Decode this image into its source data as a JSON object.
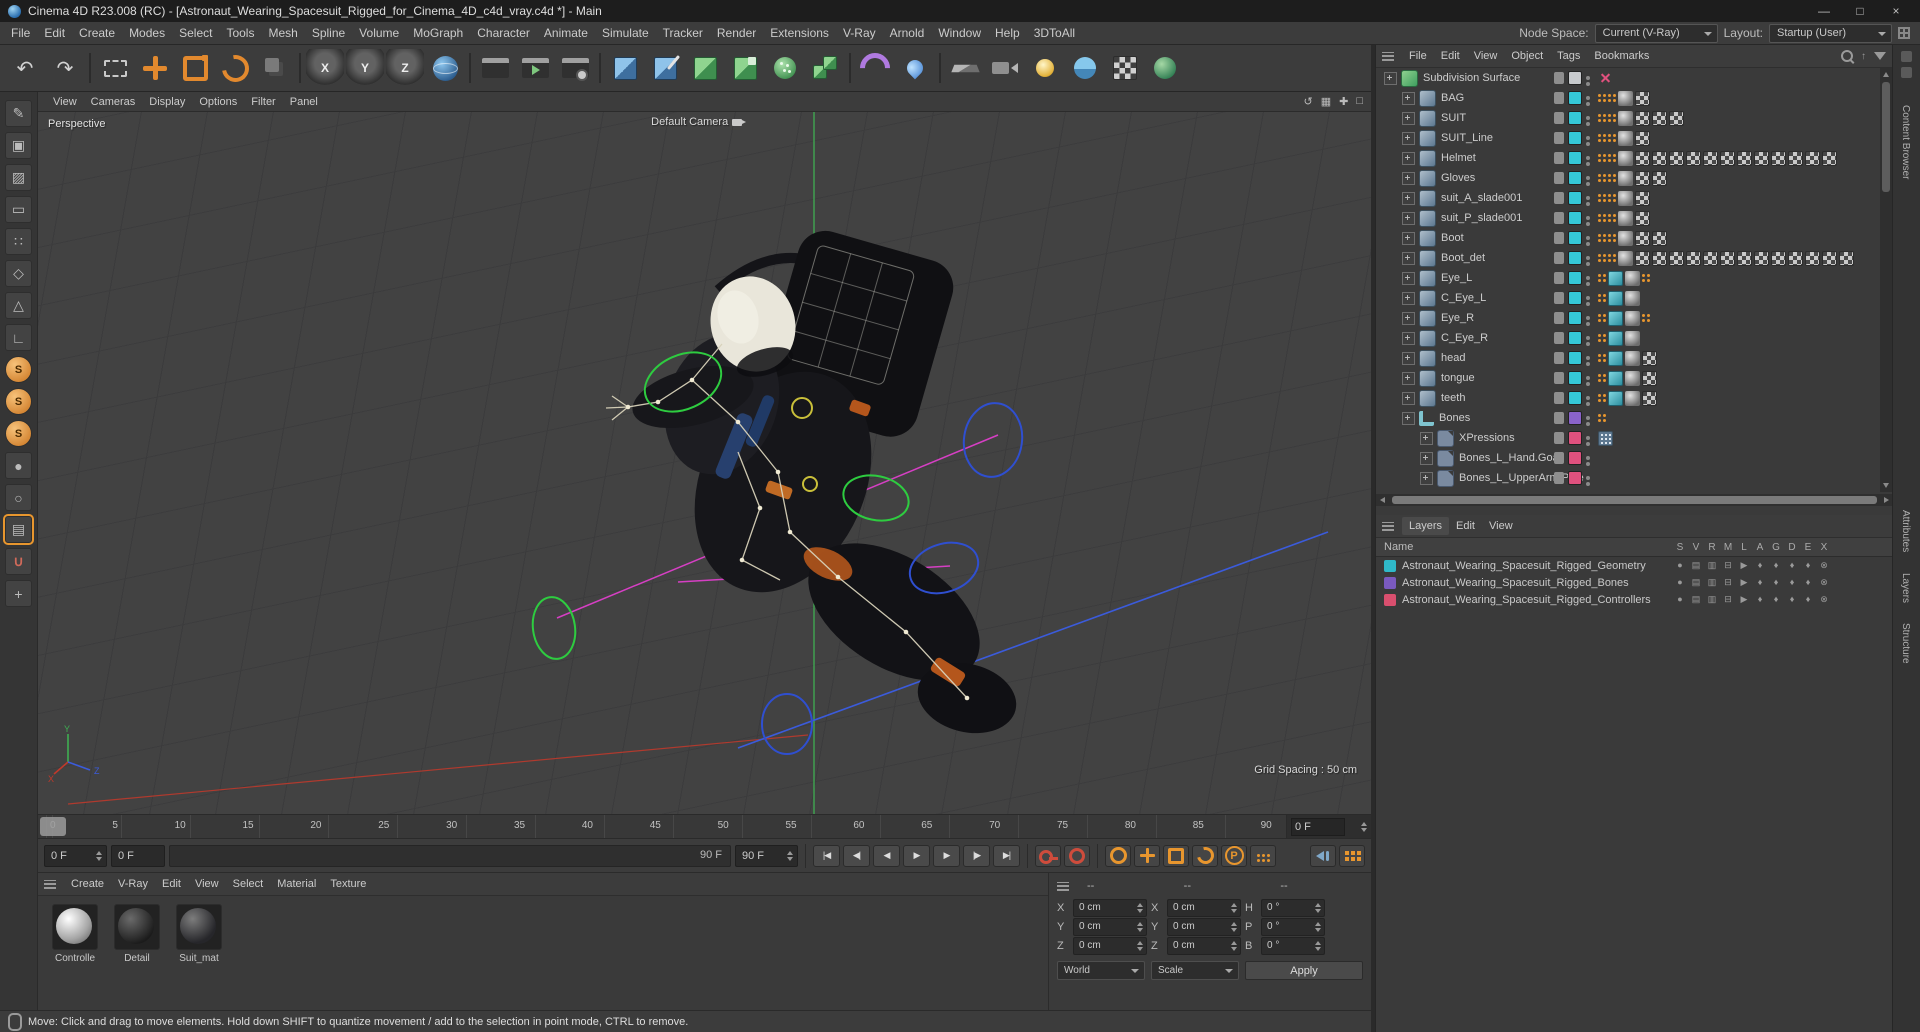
{
  "window": {
    "title": "Cinema 4D R23.008 (RC) - [Astronaut_Wearing_Spacesuit_Rigged_for_Cinema_4D_c4d_vray.c4d *] - Main",
    "min": "—",
    "max": "□",
    "close": "×"
  },
  "menubar": {
    "items": [
      "File",
      "Edit",
      "Create",
      "Modes",
      "Select",
      "Tools",
      "Mesh",
      "Spline",
      "Volume",
      "MoGraph",
      "Character",
      "Animate",
      "Simulate",
      "Tracker",
      "Render",
      "Extensions",
      "V-Ray",
      "Arnold",
      "Window",
      "Help",
      "3DToAll"
    ],
    "node_space_label": "Node Space:",
    "node_space_value": "Current (V-Ray)",
    "layout_label": "Layout:",
    "layout_value": "Startup (User)"
  },
  "toolbar": {
    "buttons": [
      {
        "name": "undo-button",
        "icon": "glyph",
        "glyph": "↶"
      },
      {
        "name": "redo-button",
        "icon": "glyph",
        "glyph": "↷"
      },
      {
        "name": "separator",
        "icon": "sep"
      },
      {
        "name": "live-selection-tool",
        "icon": "sel"
      },
      {
        "name": "move-tool",
        "icon": "cross"
      },
      {
        "name": "scale-tool",
        "icon": "scale"
      },
      {
        "name": "rotate-tool",
        "icon": "rotate"
      },
      {
        "name": "last-used-tool",
        "icon": "last"
      },
      {
        "name": "separator",
        "icon": "sep"
      },
      {
        "name": "lock-x-axis",
        "icon": "letter",
        "glyph": "X"
      },
      {
        "name": "lock-y-axis",
        "icon": "letter",
        "glyph": "Y"
      },
      {
        "name": "lock-z-axis",
        "icon": "letter",
        "glyph": "Z"
      },
      {
        "name": "coordinate-system",
        "icon": "globe"
      },
      {
        "name": "separator",
        "icon": "sep"
      },
      {
        "name": "render-view",
        "icon": "clapper"
      },
      {
        "name": "render-picture-viewer",
        "icon": "clapper-play"
      },
      {
        "name": "render-settings",
        "icon": "clapper-gear"
      },
      {
        "name": "separator",
        "icon": "sep"
      },
      {
        "name": "add-cube-primitive",
        "icon": "cube-blue"
      },
      {
        "name": "spline-pen",
        "icon": "pen"
      },
      {
        "name": "subdivision-surface-generator",
        "icon": "cube-green"
      },
      {
        "name": "extrude-generator",
        "icon": "cube-green2"
      },
      {
        "name": "cloner-generator",
        "icon": "cube-green3"
      },
      {
        "name": "array-generator",
        "icon": "cube-green4"
      },
      {
        "name": "separator",
        "icon": "sep"
      },
      {
        "name": "bend-deformer",
        "icon": "bend"
      },
      {
        "name": "field-object",
        "icon": "field"
      },
      {
        "name": "separator",
        "icon": "sep"
      },
      {
        "name": "floor-object",
        "icon": "floor"
      },
      {
        "name": "camera-object",
        "icon": "camstage"
      },
      {
        "name": "light-object",
        "icon": "light"
      },
      {
        "name": "sky-object",
        "icon": "sky"
      },
      {
        "name": "material-checker",
        "icon": "checkerb"
      },
      {
        "name": "physical-sky",
        "icon": "earth"
      }
    ]
  },
  "left_toolbar": {
    "buttons": [
      {
        "name": "make-editable",
        "kind": "g",
        "glyph": "✎"
      },
      {
        "name": "model-mode",
        "kind": "g",
        "glyph": "▣"
      },
      {
        "name": "texture-mode",
        "kind": "g",
        "glyph": "▨"
      },
      {
        "name": "workplane-mode",
        "kind": "g",
        "glyph": "▭"
      },
      {
        "name": "points-mode",
        "kind": "g",
        "glyph": "∷"
      },
      {
        "name": "edges-mode",
        "kind": "g",
        "glyph": "◇"
      },
      {
        "name": "polygons-mode",
        "kind": "g",
        "glyph": "△"
      },
      {
        "name": "workplane-tool",
        "kind": "g",
        "glyph": "∟"
      },
      {
        "name": "simulation-sphere-1",
        "kind": "sphere-s",
        "glyph": "S"
      },
      {
        "name": "simulation-sphere-2",
        "kind": "sphere-s",
        "glyph": "S"
      },
      {
        "name": "simulation-sphere-3",
        "kind": "sphere-s",
        "glyph": "S"
      },
      {
        "name": "paint-tool",
        "kind": "g",
        "glyph": "●"
      },
      {
        "name": "uv-tool",
        "kind": "g",
        "glyph": "○"
      },
      {
        "name": "texture-view",
        "kind": "on",
        "glyph": "▤"
      },
      {
        "name": "snap-magnet",
        "kind": "magnet",
        "glyph": "∪"
      },
      {
        "name": "add-tool-button",
        "kind": "g",
        "glyph": "+"
      }
    ]
  },
  "viewport": {
    "menu": [
      "View",
      "Cameras",
      "Display",
      "Options",
      "Filter",
      "Panel"
    ],
    "right_icons": [
      {
        "name": "view-undo-icon",
        "glyph": "↺"
      },
      {
        "name": "view-grid-icon",
        "glyph": "▦"
      },
      {
        "name": "view-move-icon",
        "glyph": "✚"
      },
      {
        "name": "view-maximize-icon",
        "glyph": "□"
      }
    ],
    "label": "Perspective",
    "camera": "Default Camera",
    "grid": "Grid Spacing : 50 cm",
    "axes": {
      "x": "X",
      "y": "Y",
      "z": "Z"
    }
  },
  "timeline": {
    "ticks": [
      "0",
      "5",
      "10",
      "15",
      "20",
      "25",
      "30",
      "35",
      "40",
      "45",
      "50",
      "55",
      "60",
      "65",
      "70",
      "75",
      "80",
      "85",
      "90"
    ],
    "frame_field": "0 F",
    "current_value": "0 F",
    "loop_start": "0 F",
    "range_end": "90 F",
    "end_value": "90 F"
  },
  "transport": {
    "buttons": [
      {
        "name": "goto-start-button",
        "glyph": "|◀"
      },
      {
        "name": "prev-key-button",
        "glyph": "◀|"
      },
      {
        "name": "prev-frame-button",
        "glyph": "◀"
      },
      {
        "name": "play-button",
        "glyph": "▶"
      },
      {
        "name": "next-frame-button",
        "glyph": "▶"
      },
      {
        "name": "next-key-button",
        "glyph": "|▶"
      },
      {
        "name": "goto-end-button",
        "glyph": "▶|"
      }
    ],
    "record": [
      {
        "name": "record-keyframe-button",
        "kind": "key"
      },
      {
        "name": "autokey-button",
        "kind": "autokey"
      }
    ],
    "toggles": [
      {
        "name": "keyframe-filter-button",
        "kind": "gear"
      },
      {
        "name": "key-position-toggle",
        "kind": "cross2"
      },
      {
        "name": "key-scale-toggle",
        "kind": "scalebox"
      },
      {
        "name": "key-rotation-toggle",
        "kind": "rot2"
      },
      {
        "name": "key-parameter-toggle",
        "kind": "pcircle",
        "glyph": "P"
      },
      {
        "name": "key-pla-toggle",
        "kind": "dots3"
      }
    ],
    "extras": [
      {
        "name": "sound-toggle",
        "kind": "speaker"
      },
      {
        "name": "timeline-options-button",
        "kind": "dotsgrid"
      }
    ]
  },
  "materials": {
    "menu": [
      "Create",
      "V-Ray",
      "Edit",
      "View",
      "Select",
      "Material",
      "Texture"
    ],
    "items": [
      {
        "name": "Controlle",
        "kind": "mat-white"
      },
      {
        "name": "Detail",
        "kind": "mat-dark"
      },
      {
        "name": "Suit_mat",
        "kind": "mat-suit"
      }
    ]
  },
  "coords": {
    "headers": [
      "--",
      "--",
      "--"
    ],
    "rows": [
      {
        "l1": "X",
        "v1": "0 cm",
        "l2": "X",
        "v2": "0 cm",
        "l3": "H",
        "v3": "0 °"
      },
      {
        "l1": "Y",
        "v1": "0 cm",
        "l2": "Y",
        "v2": "0 cm",
        "l3": "P",
        "v3": "0 °"
      },
      {
        "l1": "Z",
        "v1": "0 cm",
        "l2": "Z",
        "v2": "0 cm",
        "l3": "B",
        "v3": "0 °"
      }
    ],
    "mode1": "World",
    "mode2": "Scale",
    "apply": "Apply"
  },
  "objects": {
    "menu": [
      "File",
      "Edit",
      "View",
      "Object",
      "Tags",
      "Bookmarks"
    ],
    "items": [
      {
        "name": "Subdivision Surface",
        "lv": "lv0",
        "icon": "ic-subd",
        "swatch": "#c7cacd",
        "tags": [
          "xmark"
        ]
      },
      {
        "name": "BAG",
        "lv": "lv1",
        "icon": "ic-mesh",
        "swatch": "#35c8d8",
        "tags": [
          "dots2",
          "dots2",
          "phong",
          "checker"
        ]
      },
      {
        "name": "SUIT",
        "lv": "lv1",
        "icon": "ic-mesh",
        "swatch": "#35c8d8",
        "tags": [
          "dots2",
          "dots2",
          "phong",
          "checker",
          "checker",
          "checker"
        ]
      },
      {
        "name": "SUIT_Line",
        "lv": "lv1",
        "icon": "ic-mesh",
        "swatch": "#35c8d8",
        "tags": [
          "dots2",
          "dots2",
          "phong",
          "checker"
        ]
      },
      {
        "name": "Helmet",
        "lv": "lv1",
        "icon": "ic-mesh",
        "swatch": "#35c8d8",
        "tags": [
          "dots2",
          "dots2",
          "phong",
          "checker",
          "checker",
          "checker",
          "checker",
          "checker",
          "checker",
          "checker",
          "checker",
          "checker",
          "checker",
          "checker",
          "checker"
        ]
      },
      {
        "name": "Gloves",
        "lv": "lv1",
        "icon": "ic-mesh",
        "swatch": "#35c8d8",
        "tags": [
          "dots2",
          "dots2",
          "phong",
          "checker",
          "checker"
        ]
      },
      {
        "name": "suit_A_slade001",
        "lv": "lv1",
        "icon": "ic-mesh",
        "swatch": "#35c8d8",
        "tags": [
          "dots2",
          "dots2",
          "phong",
          "checker"
        ]
      },
      {
        "name": "suit_P_slade001",
        "lv": "lv1",
        "icon": "ic-mesh",
        "swatch": "#35c8d8",
        "tags": [
          "dots2",
          "dots2",
          "phong",
          "checker"
        ]
      },
      {
        "name": "Boot",
        "lv": "lv1",
        "icon": "ic-mesh",
        "swatch": "#35c8d8",
        "tags": [
          "dots2",
          "dots2",
          "phong",
          "checker",
          "checker"
        ]
      },
      {
        "name": "Boot_det",
        "lv": "lv1",
        "icon": "ic-mesh",
        "swatch": "#35c8d8",
        "tags": [
          "dots2",
          "dots2",
          "phong",
          "checker",
          "checker",
          "checker",
          "checker",
          "checker",
          "checker",
          "checker",
          "checker",
          "checker",
          "checker",
          "checker",
          "checker",
          "checker"
        ]
      },
      {
        "name": "Eye_L",
        "lv": "lv1",
        "icon": "ic-mesh",
        "swatch": "#35c8d8",
        "tags": [
          "dots2",
          "skin",
          "phong",
          "dots2"
        ]
      },
      {
        "name": "C_Eye_L",
        "lv": "lv1",
        "icon": "ic-mesh",
        "swatch": "#35c8d8",
        "tags": [
          "dots2",
          "skin",
          "phong"
        ]
      },
      {
        "name": "Eye_R",
        "lv": "lv1",
        "icon": "ic-mesh",
        "swatch": "#35c8d8",
        "tags": [
          "dots2",
          "skin",
          "phong",
          "dots2"
        ]
      },
      {
        "name": "C_Eye_R",
        "lv": "lv1",
        "icon": "ic-mesh",
        "swatch": "#35c8d8",
        "tags": [
          "dots2",
          "skin",
          "phong"
        ]
      },
      {
        "name": "head",
        "lv": "lv1",
        "icon": "ic-mesh",
        "swatch": "#35c8d8",
        "tags": [
          "dots2",
          "skin",
          "phong",
          "checker"
        ]
      },
      {
        "name": "tongue",
        "lv": "lv1",
        "icon": "ic-mesh",
        "swatch": "#35c8d8",
        "tags": [
          "dots2",
          "skin",
          "phong",
          "checker"
        ]
      },
      {
        "name": "teeth",
        "lv": "lv1",
        "icon": "ic-mesh",
        "swatch": "#35c8d8",
        "tags": [
          "dots2",
          "skin",
          "phong",
          "checker"
        ]
      },
      {
        "name": "Bones",
        "lv": "lv1",
        "icon": "ic-bone",
        "swatch": "#8a63c9",
        "tags": [
          "dots2"
        ]
      },
      {
        "name": "XPressions",
        "lv": "lv2",
        "icon": "ic-xp",
        "swatch": "#e0517e",
        "tags": [
          "matrix"
        ]
      },
      {
        "name": "Bones_L_Hand.Goal",
        "lv": "lv2",
        "icon": "ic-xp",
        "swatch": "#e0517e",
        "tags": []
      },
      {
        "name": "Bones_L_UpperArm.Pole",
        "lv": "lv2",
        "icon": "ic-xp",
        "swatch": "#e0517e",
        "tags": []
      }
    ]
  },
  "layers": {
    "tabs": [
      "Layers",
      "Edit",
      "View"
    ],
    "name_header": "Name",
    "columns": [
      "S",
      "V",
      "R",
      "M",
      "L",
      "A",
      "G",
      "D",
      "E",
      "X"
    ],
    "rows": [
      {
        "name": "Astronaut_Wearing_Spacesuit_Rigged_Geometry",
        "color": "#2fb9c9",
        "icons": [
          "●",
          "▤",
          "▥",
          "⊟",
          "▶",
          "♦",
          "♦",
          "♦",
          "♦",
          "⊗"
        ]
      },
      {
        "name": "Astronaut_Wearing_Spacesuit_Rigged_Bones",
        "color": "#7a5abf",
        "icons": [
          "●",
          "▤",
          "▥",
          "⊟",
          "▶",
          "♦",
          "♦",
          "♦",
          "♦",
          "⊗"
        ]
      },
      {
        "name": "Astronaut_Wearing_Spacesuit_Rigged_Controllers",
        "color": "#d94f6e",
        "icons": [
          "●",
          "▤",
          "▥",
          "⊟",
          "▶",
          "♦",
          "♦",
          "♦",
          "♦",
          "⊗"
        ]
      }
    ]
  },
  "side_tabs": [
    "Content Browser",
    "Attributes",
    "Layers",
    "Structure"
  ],
  "status": {
    "text": "Move: Click and drag to move elements. Hold down SHIFT to quantize movement / add to the selection in point mode, CTRL to remove."
  }
}
